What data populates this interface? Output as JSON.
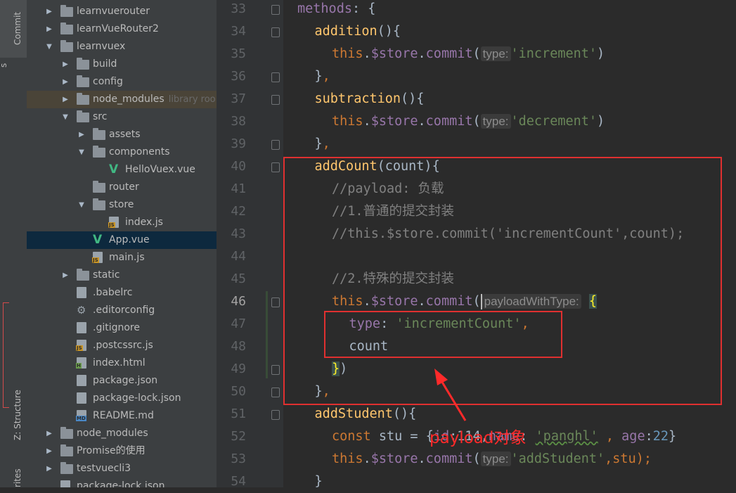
{
  "tool_strip": {
    "commit_label": "Commit",
    "structure_label": "Z: Structure",
    "favorites_label": "rites",
    "misc_label": "s"
  },
  "tree": [
    {
      "label": "learnvuerouter",
      "type": "folder",
      "depth": 0,
      "arrow": "right",
      "icon": "folder-icon"
    },
    {
      "label": "learnVueRouter2",
      "type": "folder",
      "depth": 0,
      "arrow": "right",
      "icon": "folder-icon"
    },
    {
      "label": "learnvuex",
      "type": "folder",
      "depth": 0,
      "arrow": "down",
      "icon": "folder-icon"
    },
    {
      "label": "build",
      "type": "folder",
      "depth": 1,
      "arrow": "right",
      "icon": "folder-icon"
    },
    {
      "label": "config",
      "type": "folder",
      "depth": 1,
      "arrow": "right",
      "icon": "folder-icon"
    },
    {
      "label": "node_modules",
      "suffix": "library roo",
      "type": "folder",
      "depth": 1,
      "arrow": "right",
      "icon": "folder-icon",
      "library": true
    },
    {
      "label": "src",
      "type": "folder",
      "depth": 1,
      "arrow": "down",
      "icon": "folder-icon"
    },
    {
      "label": "assets",
      "type": "folder",
      "depth": 2,
      "arrow": "right",
      "icon": "folder-icon"
    },
    {
      "label": "components",
      "type": "folder",
      "depth": 2,
      "arrow": "down",
      "icon": "folder-icon"
    },
    {
      "label": "HelloVuex.vue",
      "type": "vue",
      "depth": 3,
      "arrow": "",
      "icon": "vue-icon"
    },
    {
      "label": "router",
      "type": "folder",
      "depth": 2,
      "arrow": "",
      "icon": "folder-icon"
    },
    {
      "label": "store",
      "type": "folder",
      "depth": 2,
      "arrow": "down",
      "icon": "folder-icon"
    },
    {
      "label": "index.js",
      "type": "js",
      "depth": 3,
      "arrow": "",
      "icon": "js-file-icon"
    },
    {
      "label": "App.vue",
      "type": "vue",
      "depth": 2,
      "arrow": "",
      "icon": "vue-icon",
      "selected": true
    },
    {
      "label": "main.js",
      "type": "js",
      "depth": 2,
      "arrow": "",
      "icon": "js-file-icon"
    },
    {
      "label": "static",
      "type": "folder",
      "depth": 1,
      "arrow": "right",
      "icon": "folder-icon"
    },
    {
      "label": ".babelrc",
      "type": "file",
      "depth": 1,
      "arrow": "",
      "icon": "config-file-icon"
    },
    {
      "label": ".editorconfig",
      "type": "gear",
      "depth": 1,
      "arrow": "",
      "icon": "gear-icon"
    },
    {
      "label": ".gitignore",
      "type": "file",
      "depth": 1,
      "arrow": "",
      "icon": "file-icon"
    },
    {
      "label": ".postcssrc.js",
      "type": "js",
      "depth": 1,
      "arrow": "",
      "icon": "js-file-icon"
    },
    {
      "label": "index.html",
      "type": "html",
      "depth": 1,
      "arrow": "",
      "icon": "html-file-icon"
    },
    {
      "label": "package.json",
      "type": "file",
      "depth": 1,
      "arrow": "",
      "icon": "json-file-icon"
    },
    {
      "label": "package-lock.json",
      "type": "file",
      "depth": 1,
      "arrow": "",
      "icon": "json-file-icon"
    },
    {
      "label": "README.md",
      "type": "md",
      "depth": 1,
      "arrow": "",
      "icon": "markdown-file-icon"
    },
    {
      "label": "node_modules",
      "type": "folder",
      "depth": 0,
      "arrow": "right",
      "icon": "folder-icon"
    },
    {
      "label": "Promise的使用",
      "type": "folder",
      "depth": 0,
      "arrow": "right",
      "icon": "folder-icon"
    },
    {
      "label": "testvuecli3",
      "type": "folder",
      "depth": 0,
      "arrow": "right",
      "icon": "folder-icon"
    },
    {
      "label": "package-lock.json",
      "type": "file",
      "depth": 0,
      "arrow": "",
      "icon": "json-file-icon"
    }
  ],
  "editor": {
    "current_line": "46",
    "lines": [
      {
        "no": "33",
        "fold": true,
        "indent": 0,
        "tokens": [
          {
            "t": "methods",
            "c": "p"
          },
          {
            "t": ": {",
            "c": ""
          }
        ]
      },
      {
        "no": "34",
        "fold": true,
        "indent": 1,
        "tokens": [
          {
            "t": "addition",
            "c": "f"
          },
          {
            "t": "(){",
            "c": ""
          }
        ]
      },
      {
        "no": "35",
        "fold": false,
        "indent": 2,
        "tokens": [
          {
            "t": "this",
            "c": "k"
          },
          {
            "t": ".",
            "c": ""
          },
          {
            "t": "$store",
            "c": "p"
          },
          {
            "t": ".",
            "c": ""
          },
          {
            "t": "commit",
            "c": "p"
          },
          {
            "t": "(",
            "c": ""
          },
          {
            "t": "type:",
            "c": "hint"
          },
          {
            "t": "'increment'",
            "c": "s"
          },
          {
            "t": ")",
            "c": ""
          }
        ]
      },
      {
        "no": "36",
        "fold": true,
        "indent": 1,
        "tokens": [
          {
            "t": "}",
            "c": ""
          },
          {
            "t": ",",
            "c": "k"
          }
        ]
      },
      {
        "no": "37",
        "fold": true,
        "indent": 1,
        "tokens": [
          {
            "t": "subtraction",
            "c": "f"
          },
          {
            "t": "(){",
            "c": ""
          }
        ]
      },
      {
        "no": "38",
        "fold": false,
        "indent": 2,
        "tokens": [
          {
            "t": "this",
            "c": "k"
          },
          {
            "t": ".",
            "c": ""
          },
          {
            "t": "$store",
            "c": "p"
          },
          {
            "t": ".",
            "c": ""
          },
          {
            "t": "commit",
            "c": "p"
          },
          {
            "t": "(",
            "c": ""
          },
          {
            "t": "type:",
            "c": "hint"
          },
          {
            "t": "'decrement'",
            "c": "s"
          },
          {
            "t": ")",
            "c": ""
          }
        ]
      },
      {
        "no": "39",
        "fold": true,
        "indent": 1,
        "tokens": [
          {
            "t": "}",
            "c": ""
          },
          {
            "t": ",",
            "c": "k"
          }
        ]
      },
      {
        "no": "40",
        "fold": true,
        "indent": 1,
        "tokens": [
          {
            "t": "addCount",
            "c": "f"
          },
          {
            "t": "(count){",
            "c": ""
          }
        ]
      },
      {
        "no": "41",
        "fold": false,
        "indent": 2,
        "tokens": [
          {
            "t": "//payload: 负载",
            "c": "c"
          }
        ]
      },
      {
        "no": "42",
        "fold": false,
        "indent": 2,
        "tokens": [
          {
            "t": "//1.普通的提交封装",
            "c": "c"
          }
        ]
      },
      {
        "no": "43",
        "fold": false,
        "indent": 2,
        "tokens": [
          {
            "t": "//this.$store.commit('incrementCount',count);",
            "c": "c"
          }
        ]
      },
      {
        "no": "44",
        "fold": false,
        "indent": 0,
        "tokens": []
      },
      {
        "no": "45",
        "fold": false,
        "indent": 2,
        "tokens": [
          {
            "t": "//2.特殊的提交封装",
            "c": "c"
          }
        ]
      },
      {
        "no": "46",
        "fold": true,
        "indent": 2,
        "tokens": [
          {
            "t": "this",
            "c": "k"
          },
          {
            "t": ".",
            "c": ""
          },
          {
            "t": "$store",
            "c": "p"
          },
          {
            "t": ".",
            "c": ""
          },
          {
            "t": "commit",
            "c": "p"
          },
          {
            "t": "(",
            "c": ""
          },
          {
            "t": "",
            "c": "caret"
          },
          {
            "t": "payloadWithType:",
            "c": "hint"
          },
          {
            "t": " ",
            "c": ""
          },
          {
            "t": "{",
            "c": "brace"
          }
        ]
      },
      {
        "no": "47",
        "fold": false,
        "indent": 3,
        "tokens": [
          {
            "t": "type",
            "c": "p"
          },
          {
            "t": ": ",
            "c": ""
          },
          {
            "t": "'incrementCount'",
            "c": "s"
          },
          {
            "t": ",",
            "c": "k"
          }
        ]
      },
      {
        "no": "48",
        "fold": false,
        "indent": 3,
        "tokens": [
          {
            "t": "count",
            "c": ""
          }
        ]
      },
      {
        "no": "49",
        "fold": true,
        "indent": 2,
        "tokens": [
          {
            "t": "}",
            "c": "brace"
          },
          {
            "t": ")",
            "c": ""
          }
        ]
      },
      {
        "no": "50",
        "fold": true,
        "indent": 1,
        "tokens": [
          {
            "t": "}",
            "c": ""
          },
          {
            "t": ",",
            "c": "k"
          }
        ]
      },
      {
        "no": "51",
        "fold": true,
        "indent": 1,
        "tokens": [
          {
            "t": "addStudent",
            "c": "f"
          },
          {
            "t": "(){",
            "c": ""
          }
        ]
      },
      {
        "no": "52",
        "fold": false,
        "indent": 2,
        "tokens": [
          {
            "t": "const",
            "c": "k"
          },
          {
            "t": " stu = {",
            "c": ""
          },
          {
            "t": "id",
            "c": "p"
          },
          {
            "t": ":114,",
            "c": ""
          },
          {
            "t": "name",
            "c": "p"
          },
          {
            "t": ": ",
            "c": ""
          },
          {
            "t": "'panghl'",
            "c": "s squig"
          },
          {
            "t": " , ",
            "c": "k"
          },
          {
            "t": "age",
            "c": "p"
          },
          {
            "t": ":",
            "c": ""
          },
          {
            "t": "22",
            "c": "n"
          },
          {
            "t": "}",
            "c": ""
          }
        ]
      },
      {
        "no": "53",
        "fold": false,
        "indent": 2,
        "tokens": [
          {
            "t": "this",
            "c": "k"
          },
          {
            "t": ".",
            "c": ""
          },
          {
            "t": "$store",
            "c": "p"
          },
          {
            "t": ".",
            "c": ""
          },
          {
            "t": "commit",
            "c": "p"
          },
          {
            "t": "(",
            "c": ""
          },
          {
            "t": "type:",
            "c": "hint"
          },
          {
            "t": "'addStudent'",
            "c": "s"
          },
          {
            "t": ",stu);",
            "c": "k"
          }
        ]
      },
      {
        "no": "54",
        "fold": false,
        "indent": 1,
        "tokens": [
          {
            "t": "}",
            "c": ""
          }
        ]
      }
    ]
  },
  "annotation": {
    "text": "payload对象",
    "color": "#ff2a2a"
  },
  "colors": {
    "keyword": "#cc7832",
    "function": "#ffc66d",
    "string": "#6a8759",
    "comment": "#808080",
    "property": "#9876aa",
    "number": "#6897bb",
    "highlight_box": "#e03030"
  }
}
